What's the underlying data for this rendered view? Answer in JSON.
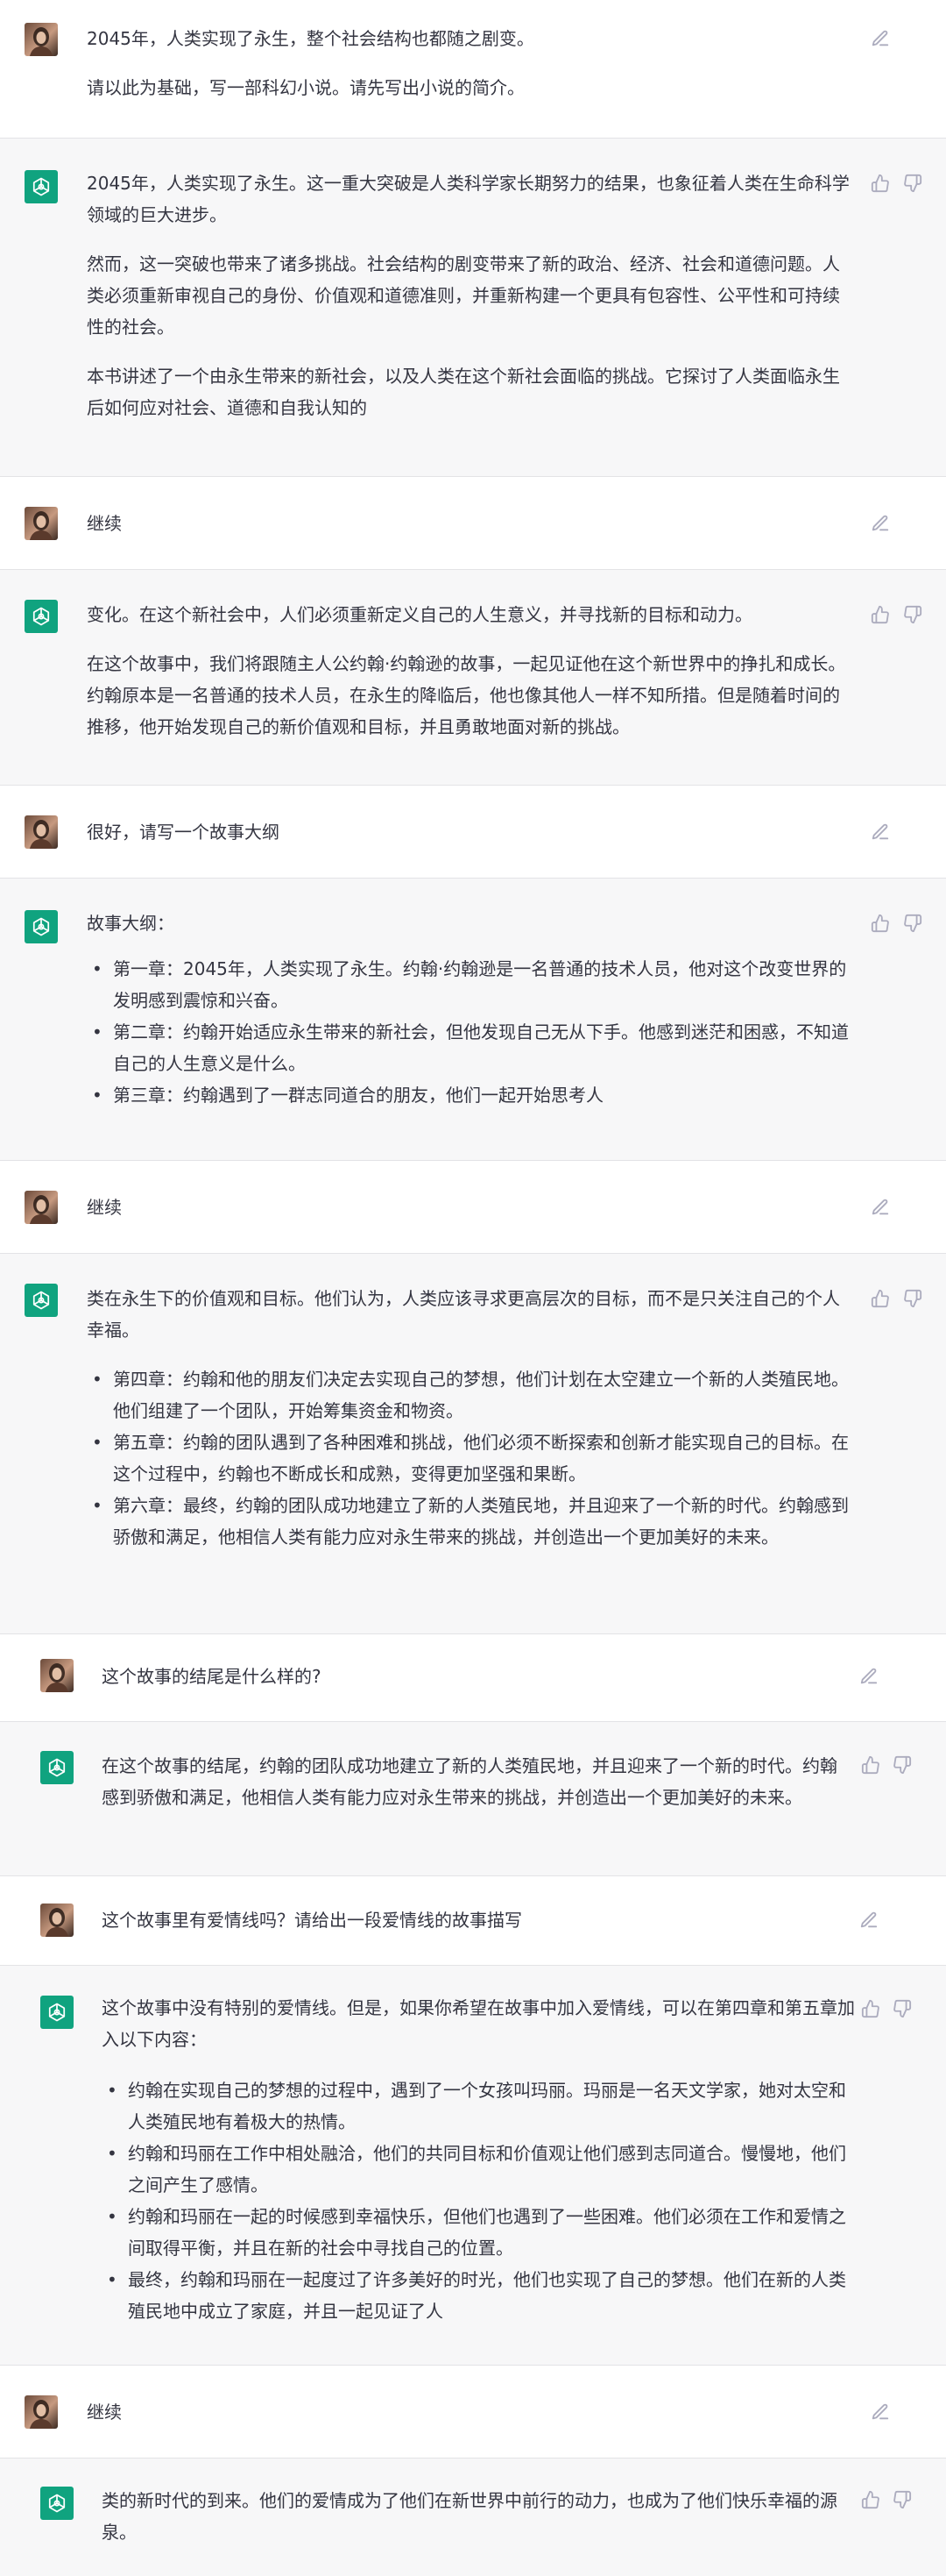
{
  "messages": [
    {
      "role": "user",
      "paragraphs": [
        "2045年，人类实现了永生，整个社会结构也都随之剧变。",
        "请以此为基础，写一部科幻小说。请先写出小说的简介。"
      ]
    },
    {
      "role": "assistant",
      "paragraphs": [
        "2045年，人类实现了永生。这一重大突破是人类科学家长期努力的结果，也象征着人类在生命科学领域的巨大进步。",
        "然而，这一突破也带来了诸多挑战。社会结构的剧变带来了新的政治、经济、社会和道德问题。人类必须重新审视自己的身份、价值观和道德准则，并重新构建一个更具有包容性、公平性和可持续性的社会。",
        "本书讲述了一个由永生带来的新社会，以及人类在这个新社会面临的挑战。它探讨了人类面临永生后如何应对社会、道德和自我认知的"
      ]
    },
    {
      "role": "user",
      "paragraphs": [
        "继续"
      ]
    },
    {
      "role": "assistant",
      "paragraphs": [
        "变化。在这个新社会中，人们必须重新定义自己的人生意义，并寻找新的目标和动力。",
        "在这个故事中，我们将跟随主人公约翰·约翰逊的故事，一起见证他在这个新世界中的挣扎和成长。约翰原本是一名普通的技术人员，在永生的降临后，他也像其他人一样不知所措。但是随着时间的推移，他开始发现自己的新价值观和目标，并且勇敢地面对新的挑战。"
      ]
    },
    {
      "role": "user",
      "paragraphs": [
        "很好，请写一个故事大纲"
      ]
    },
    {
      "role": "assistant",
      "paragraphs": [
        "故事大纲："
      ],
      "bullets": [
        "第一章：2045年，人类实现了永生。约翰·约翰逊是一名普通的技术人员，他对这个改变世界的发明感到震惊和兴奋。",
        "第二章：约翰开始适应永生带来的新社会，但他发现自己无从下手。他感到迷茫和困惑，不知道自己的人生意义是什么。",
        "第三章：约翰遇到了一群志同道合的朋友，他们一起开始思考人"
      ]
    },
    {
      "role": "user",
      "paragraphs": [
        "继续"
      ]
    },
    {
      "role": "assistant",
      "paragraphs": [
        "类在永生下的价值观和目标。他们认为，人类应该寻求更高层次的目标，而不是只关注自己的个人幸福。"
      ],
      "bullets": [
        "第四章：约翰和他的朋友们决定去实现自己的梦想，他们计划在太空建立一个新的人类殖民地。他们组建了一个团队，开始筹集资金和物资。",
        "第五章：约翰的团队遇到了各种困难和挑战，他们必须不断探索和创新才能实现自己的目标。在这个过程中，约翰也不断成长和成熟，变得更加坚强和果断。",
        "第六章：最终，约翰的团队成功地建立了新的人类殖民地，并且迎来了一个新的时代。约翰感到骄傲和满足，他相信人类有能力应对永生带来的挑战，并创造出一个更加美好的未来。"
      ]
    },
    {
      "role": "user",
      "paragraphs": [
        "这个故事的结尾是什么样的?"
      ]
    },
    {
      "role": "assistant",
      "paragraphs": [
        "在这个故事的结尾，约翰的团队成功地建立了新的人类殖民地，并且迎来了一个新的时代。约翰感到骄傲和满足，他相信人类有能力应对永生带来的挑战，并创造出一个更加美好的未来。"
      ]
    },
    {
      "role": "user",
      "paragraphs": [
        "这个故事里有爱情线吗？请给出一段爱情线的故事描写"
      ]
    },
    {
      "role": "assistant",
      "paragraphs": [
        "这个故事中没有特别的爱情线。但是，如果你希望在故事中加入爱情线，可以在第四章和第五章加入以下内容："
      ],
      "bullets": [
        "约翰在实现自己的梦想的过程中，遇到了一个女孩叫玛丽。玛丽是一名天文学家，她对太空和人类殖民地有着极大的热情。",
        "约翰和玛丽在工作中相处融洽，他们的共同目标和价值观让他们感到志同道合。慢慢地，他们之间产生了感情。",
        "约翰和玛丽在一起的时候感到幸福快乐，但他们也遇到了一些困难。他们必须在工作和爱情之间取得平衡，并且在新的社会中寻找自己的位置。",
        "最终，约翰和玛丽在一起度过了许多美好的时光，他们也实现了自己的梦想。他们在新的人类殖民地中成立了家庭，并且一起见证了人"
      ]
    },
    {
      "role": "user",
      "paragraphs": [
        "继续"
      ]
    },
    {
      "role": "assistant",
      "paragraphs": [
        "类的新时代的到来。他们的爱情成为了他们在新世界中前行的动力，也成为了他们快乐幸福的源泉。"
      ]
    }
  ],
  "colors": {
    "ai_avatar": "#10a37f",
    "assistant_bg": "#f7f7f8",
    "user_bg": "#ffffff",
    "icon": "#acacbe"
  },
  "icons": {
    "user_avatar": "user-photo-avatar",
    "ai_avatar": "openai-logo-icon",
    "edit": "edit-icon",
    "thumbs_up": "thumbs-up-icon",
    "thumbs_down": "thumbs-down-icon"
  }
}
